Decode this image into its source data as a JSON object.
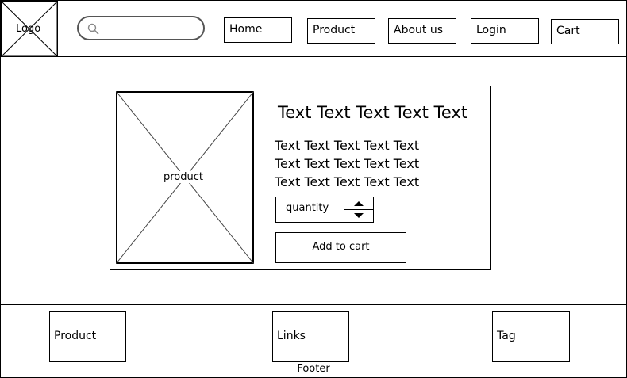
{
  "header": {
    "logo_label": "Logo",
    "search": {
      "placeholder": ""
    },
    "nav": [
      "Home",
      "Product",
      "About us",
      "Login",
      "Cart"
    ]
  },
  "product": {
    "image_label": "product",
    "title": "Text Text Text Text Text",
    "description": [
      "Text Text Text Text Text",
      "Text Text Text Text Text",
      "Text Text Text Text Text"
    ],
    "quantity_label": "quantity",
    "add_to_cart": "Add to cart"
  },
  "footer": {
    "sections": [
      "Product",
      "Links",
      "Tag"
    ],
    "label": "Footer"
  }
}
